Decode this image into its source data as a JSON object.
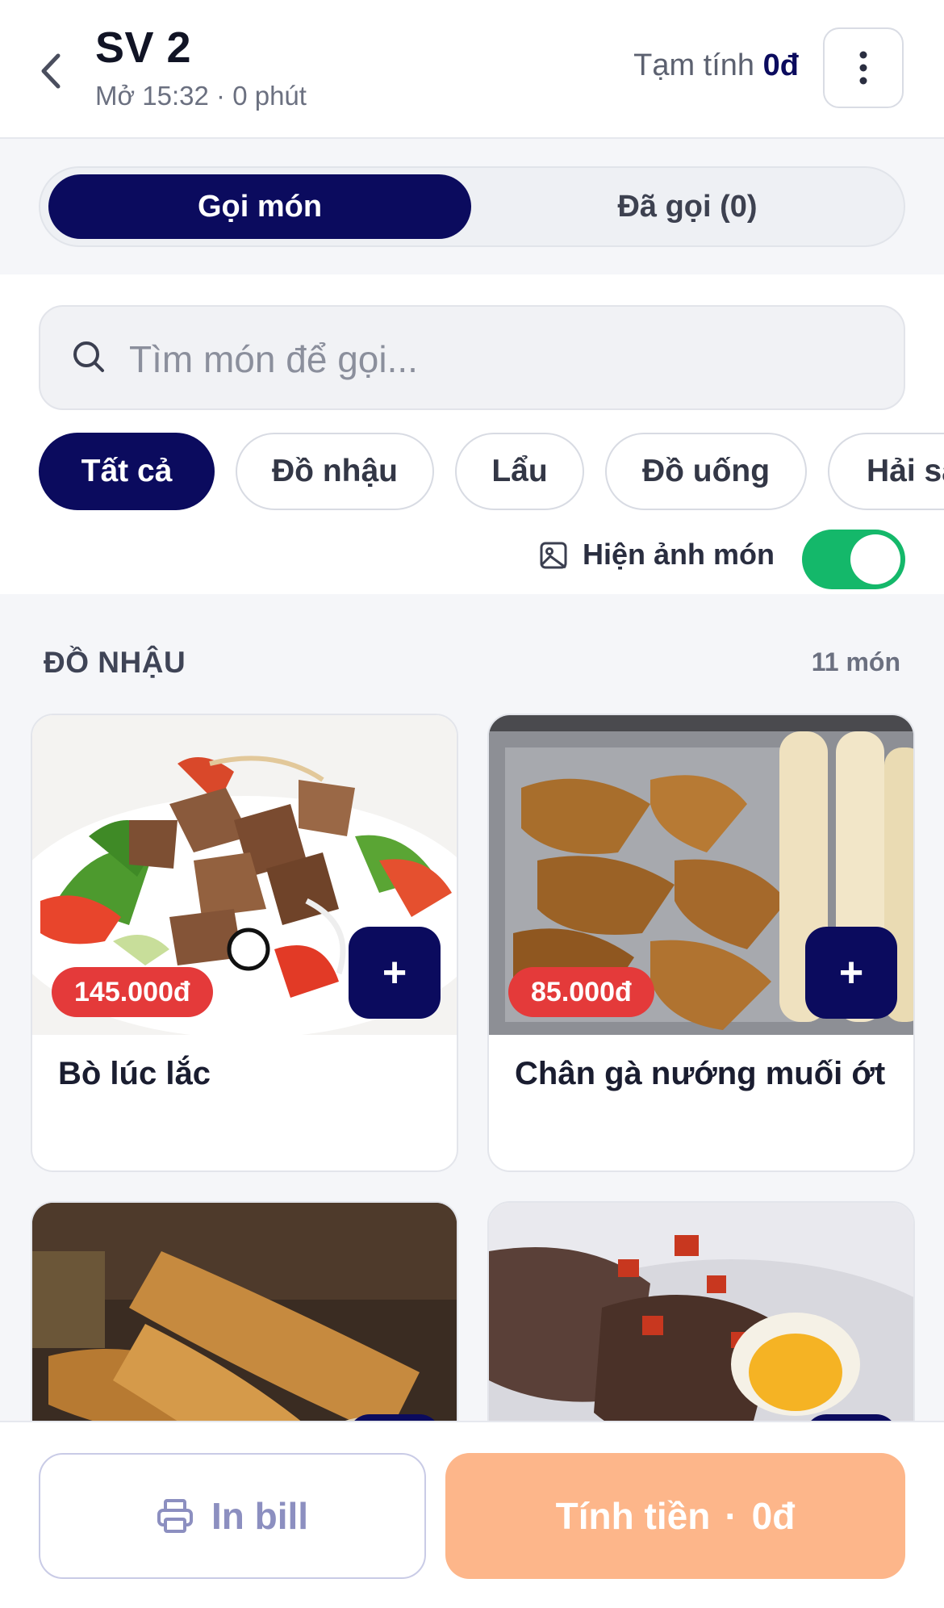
{
  "header": {
    "title": "SV 2",
    "subtitle": "Mở 15:32 · 0 phút",
    "subtotal_label": "Tạm tính",
    "subtotal_value": "0đ"
  },
  "tabs": [
    {
      "label": "Gọi món",
      "active": true
    },
    {
      "label": "Đã gọi (0)",
      "active": false
    }
  ],
  "search": {
    "placeholder": "Tìm món để gọi..."
  },
  "chips": [
    {
      "label": "Tất cả",
      "active": true
    },
    {
      "label": "Đồ nhậu",
      "active": false
    },
    {
      "label": "Lẩu",
      "active": false
    },
    {
      "label": "Đồ uống",
      "active": false
    },
    {
      "label": "Hải sản",
      "active": false
    }
  ],
  "image_toggle": {
    "label": "Hiện ảnh món",
    "on": true
  },
  "section": {
    "title": "ĐỒ NHẬU",
    "count": "11 món"
  },
  "items": [
    {
      "name": "Bò lúc lắc",
      "price": "145.000đ",
      "add": "+"
    },
    {
      "name": "Chân gà nướng muối ớt",
      "price": "85.000đ",
      "add": "+"
    },
    {
      "name": "",
      "price": "",
      "add": "+"
    },
    {
      "name": "",
      "price": "",
      "add": "+"
    }
  ],
  "bottom": {
    "print_label": "In bill",
    "pay_label": "Tính tiền",
    "pay_value": "0đ"
  },
  "colors": {
    "primary": "#0b0b5e",
    "price_badge": "#e43a3a",
    "toggle_on": "#14b86a",
    "pay_button": "#fdb68a"
  },
  "icons": [
    "chevron-left-icon",
    "more-vertical-icon",
    "search-icon",
    "image-icon",
    "printer-icon",
    "plus-icon"
  ]
}
